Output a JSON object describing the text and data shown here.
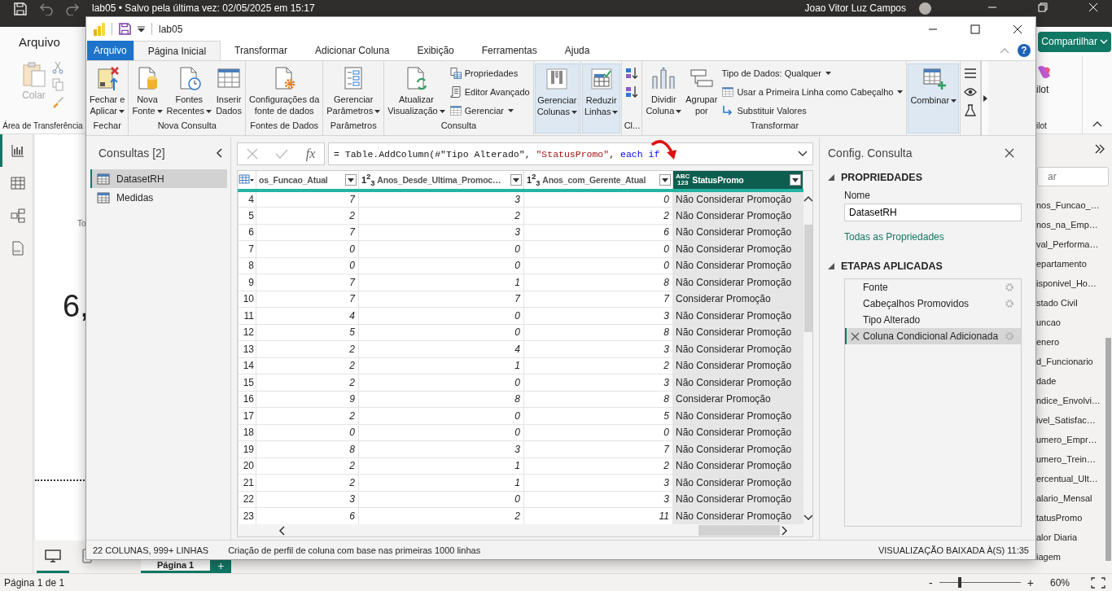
{
  "app": {
    "title": "lab05 • Salvo pela última vez: 02/05/2025 em 15:17",
    "user": "Joao Vitor Luz Campos"
  },
  "app_ribbon": {
    "file_tab": "Arquivo",
    "paste_label": "Colar",
    "clipboard_group": "Área de Transferência",
    "share_button": "Compartilhar",
    "copilot_label": "ilot",
    "copilot_group": "ilot"
  },
  "canvas": {
    "fragments": [
      {
        "kind": "caption",
        "text": "To"
      },
      {
        "kind": "value",
        "text": "6,"
      }
    ]
  },
  "pages": {
    "tab": "Página 1",
    "add": "+"
  },
  "fields_pane": {
    "search_placeholder": "ar",
    "fields": [
      "nos_Funcao_…",
      "nos_na_Emp…",
      "val_Performa…",
      "epartamento",
      "isponivel_Ho…",
      "stado Civil",
      "uncao",
      "enero",
      "d_Funcionario",
      "dade",
      "ndice_Envolvi…",
      "ivel_Satisfac…",
      "umero_Empr…",
      "umero_Trein…",
      "ercentual_Ult…",
      "alario_Mensal",
      "tatusPromo",
      "alor Diaria",
      "iagem"
    ]
  },
  "app_status": {
    "page": "Página 1 de 1",
    "zoom_out": "-",
    "zoom_in": "+",
    "zoom": "60%",
    "level": 0.25
  },
  "editor": {
    "title": "lab05",
    "help": "?",
    "tabs": [
      {
        "label": "Arquivo",
        "kind": "file",
        "selected": false
      },
      {
        "label": "Página Inicial",
        "kind": "tab",
        "selected": true
      },
      {
        "label": "Transformar",
        "kind": "tab",
        "selected": false
      },
      {
        "label": "Adicionar Coluna",
        "kind": "tab",
        "selected": false
      },
      {
        "label": "Exibição",
        "kind": "tab",
        "selected": false
      },
      {
        "label": "Ferramentas",
        "kind": "tab",
        "selected": false
      },
      {
        "label": "Ajuda",
        "kind": "tab",
        "selected": false
      }
    ],
    "ribbon_groups": [
      {
        "kind": "group",
        "label": "Fechar",
        "items": [
          {
            "kind": "large",
            "label": "Fechar e\nAplicar",
            "dropdown": true
          }
        ]
      },
      {
        "kind": "group",
        "label": "Nova Consulta",
        "items": [
          {
            "kind": "large",
            "label": "Nova\nFonte",
            "dropdown": true
          },
          {
            "kind": "large",
            "label": "Fontes\nRecentes",
            "dropdown": true
          },
          {
            "kind": "large",
            "label": "Inserir\nDados",
            "dropdown": false
          }
        ]
      },
      {
        "kind": "group",
        "label": "Fontes de Dados",
        "items": [
          {
            "kind": "large",
            "label": "Configurações da\nfonte de dados",
            "dropdown": false
          }
        ]
      },
      {
        "kind": "group",
        "label": "Parâmetros",
        "items": [
          {
            "kind": "large",
            "label": "Gerenciar\nParâmetros",
            "dropdown": true
          }
        ]
      },
      {
        "kind": "group",
        "label": "Consulta",
        "items": [
          {
            "kind": "large",
            "label": "Atualizar\nVisualização",
            "dropdown": true
          },
          {
            "kind": "small",
            "label": "Propriedades",
            "dropdown": false
          },
          {
            "kind": "small",
            "label": "Editor Avançado",
            "dropdown": false
          },
          {
            "kind": "small",
            "label": "Gerenciar",
            "dropdown": true
          }
        ]
      },
      {
        "kind": "collapsed",
        "items": [
          {
            "kind": "large",
            "label": "Gerenciar\nColunas",
            "dropdown": true
          }
        ]
      },
      {
        "kind": "collapsed",
        "items": [
          {
            "kind": "large",
            "label": "Reduzir\nLinhas",
            "dropdown": true
          }
        ]
      },
      {
        "kind": "group",
        "label": "Cl...",
        "items": [
          {
            "kind": "icon"
          },
          {
            "kind": "icon"
          }
        ]
      },
      {
        "kind": "group",
        "label": "Transformar",
        "items": [
          {
            "kind": "large",
            "label": "Dividir\nColuna",
            "dropdown": true
          },
          {
            "kind": "large",
            "label": "Agrupar\npor",
            "dropdown": false
          },
          {
            "kind": "small",
            "label": "Tipo de Dados: Qualquer",
            "dropdown": true
          },
          {
            "kind": "small",
            "label": "Usar a Primeira Linha como Cabeçalho",
            "dropdown": true
          },
          {
            "kind": "small",
            "label": "Substituir Valores",
            "dropdown": false
          }
        ]
      },
      {
        "kind": "collapsed",
        "items": [
          {
            "kind": "large",
            "label": "Combinar",
            "dropdown": true
          }
        ]
      },
      {
        "kind": "group",
        "items": [
          {
            "kind": "icon"
          },
          {
            "kind": "icon"
          },
          {
            "kind": "icon"
          }
        ]
      }
    ],
    "formula_button": "fx",
    "formula": [
      {
        "kind": "plain",
        "text": "= Table.AddColumn(#\"Tipo Alterado\", "
      },
      {
        "kind": "string",
        "text": "\"StatusPromo\""
      },
      {
        "kind": "plain",
        "text": ", "
      },
      {
        "kind": "keyword",
        "text": "each if"
      }
    ],
    "queries": {
      "title": "Consultas [2]",
      "items": [
        {
          "label": "DatasetRH",
          "selected": true
        },
        {
          "label": "Medidas",
          "selected": false
        }
      ]
    },
    "table": {
      "columns": [
        {
          "label": "os_Funcao_Atual",
          "selected": false
        },
        {
          "label": "Anos_Desde_Ultima_Promoc…",
          "type": "1$^{2}$$_{3}$",
          "selected": false
        },
        {
          "label": "Anos_com_Gerente_Atual",
          "type": "1$^{2}$$_{3}$",
          "selected": false
        },
        {
          "label": "StatusPromo",
          "type": "ABC\n123",
          "selected": true
        }
      ],
      "rows": [
        {
          "n": "4",
          "cells": [
            "7",
            "3",
            "0",
            "Não Considerar Promoção"
          ]
        },
        {
          "n": "5",
          "cells": [
            "2",
            "2",
            "2",
            "Não Considerar Promoção"
          ]
        },
        {
          "n": "6",
          "cells": [
            "7",
            "3",
            "6",
            "Não Considerar Promoção"
          ]
        },
        {
          "n": "7",
          "cells": [
            "0",
            "0",
            "0",
            "Não Considerar Promoção"
          ]
        },
        {
          "n": "8",
          "cells": [
            "0",
            "0",
            "0",
            "Não Considerar Promoção"
          ]
        },
        {
          "n": "9",
          "cells": [
            "7",
            "1",
            "8",
            "Não Considerar Promoção"
          ]
        },
        {
          "n": "10",
          "cells": [
            "7",
            "7",
            "7",
            "Considerar Promoção"
          ]
        },
        {
          "n": "11",
          "cells": [
            "4",
            "0",
            "3",
            "Não Considerar Promoção"
          ]
        },
        {
          "n": "12",
          "cells": [
            "5",
            "0",
            "8",
            "Não Considerar Promoção"
          ]
        },
        {
          "n": "13",
          "cells": [
            "2",
            "4",
            "3",
            "Não Considerar Promoção"
          ]
        },
        {
          "n": "14",
          "cells": [
            "2",
            "1",
            "2",
            "Não Considerar Promoção"
          ]
        },
        {
          "n": "15",
          "cells": [
            "2",
            "0",
            "3",
            "Não Considerar Promoção"
          ]
        },
        {
          "n": "16",
          "cells": [
            "9",
            "8",
            "8",
            "Considerar Promoção"
          ]
        },
        {
          "n": "17",
          "cells": [
            "2",
            "0",
            "5",
            "Não Considerar Promoção"
          ]
        },
        {
          "n": "18",
          "cells": [
            "0",
            "0",
            "0",
            "Não Considerar Promoção"
          ]
        },
        {
          "n": "19",
          "cells": [
            "8",
            "3",
            "7",
            "Não Considerar Promoção"
          ]
        },
        {
          "n": "20",
          "cells": [
            "2",
            "1",
            "2",
            "Não Considerar Promoção"
          ]
        },
        {
          "n": "21",
          "cells": [
            "2",
            "1",
            "3",
            "Não Considerar Promoção"
          ]
        },
        {
          "n": "22",
          "cells": [
            "3",
            "0",
            "3",
            "Não Considerar Promoção"
          ]
        },
        {
          "n": "23",
          "cells": [
            "6",
            "2",
            "11",
            "Não Considerar Promoção"
          ]
        }
      ]
    },
    "settings": {
      "title": "Config. Consulta",
      "properties_heading": "PROPRIEDADES",
      "name_label": "Nome",
      "name_value": "DatasetRH",
      "all_properties_link": "Todas as Propriedades",
      "steps_heading": "ETAPAS APLICADAS",
      "steps": [
        {
          "label": "Fonte",
          "has_settings": true,
          "selected": false
        },
        {
          "label": "Cabeçalhos Promovidos",
          "has_settings": true,
          "selected": false
        },
        {
          "label": "Tipo Alterado",
          "has_settings": false,
          "selected": false
        },
        {
          "label": "Coluna Condicional Adicionada",
          "has_settings": true,
          "selected": true
        }
      ]
    },
    "status": {
      "columns": "22 COLUNAS, 999+ LINHAS",
      "profiling": "Criação de perfil de coluna com base nas primeiras 1000 linhas",
      "preview": "VISUALIZAÇÃO BAIXADA À(S) 11:35"
    }
  }
}
